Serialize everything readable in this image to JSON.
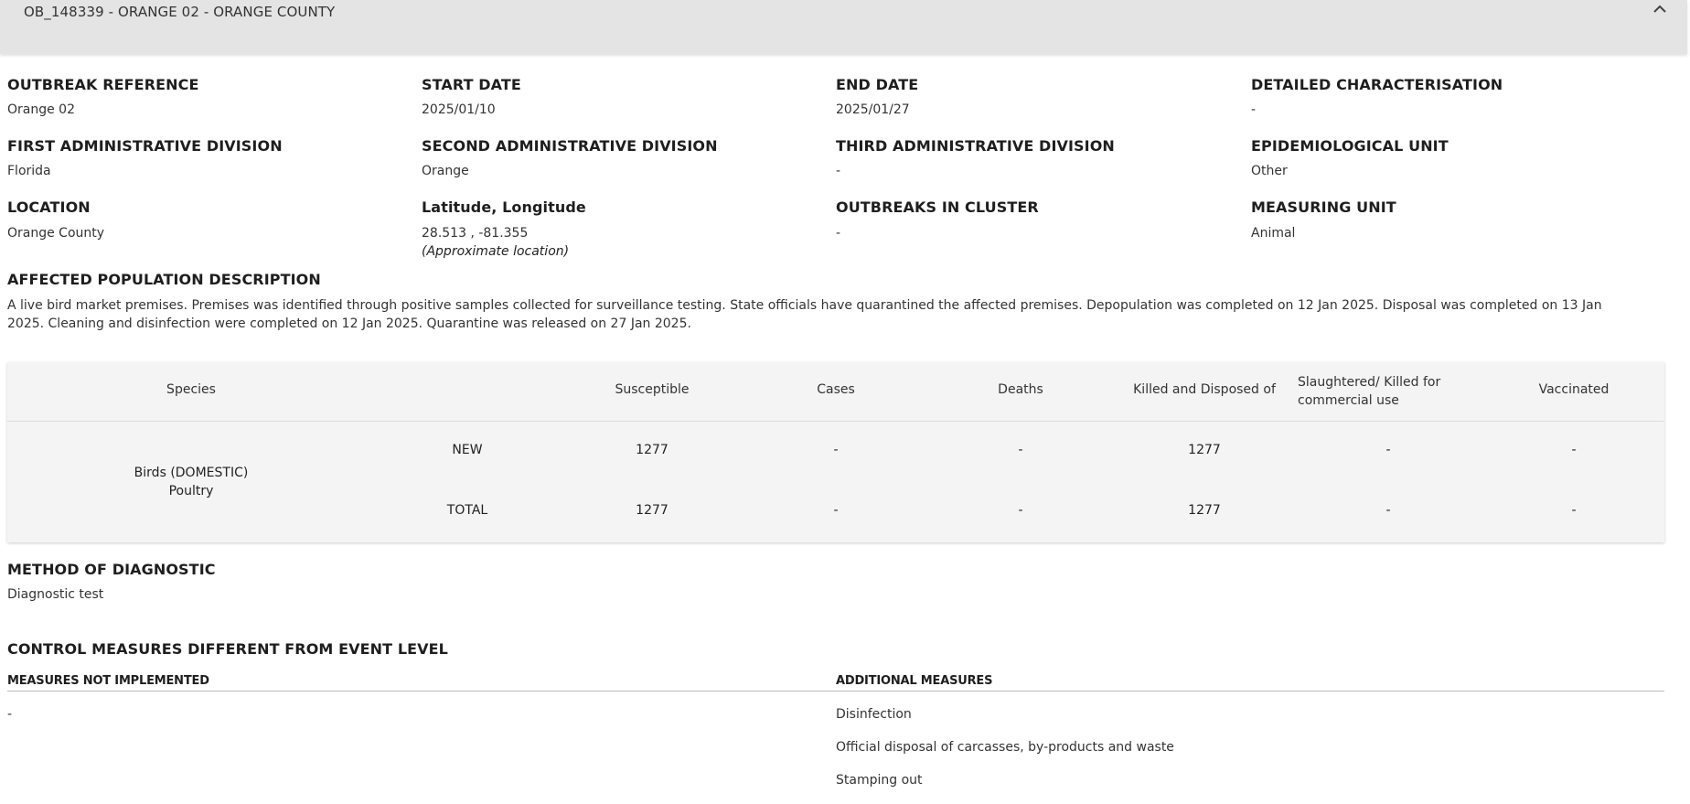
{
  "header": {
    "title": "OB_148339 - ORANGE 02 - ORANGE COUNTY"
  },
  "fields": {
    "outbreak_reference": {
      "label": "OUTBREAK REFERENCE",
      "value": "Orange 02"
    },
    "start_date": {
      "label": "START DATE",
      "value": "2025/01/10"
    },
    "end_date": {
      "label": "END DATE",
      "value": "2025/01/27"
    },
    "detailed_characterisation": {
      "label": "DETAILED CHARACTERISATION",
      "value": "-"
    },
    "first_admin_division": {
      "label": "FIRST ADMINISTRATIVE DIVISION",
      "value": "Florida"
    },
    "second_admin_division": {
      "label": "SECOND ADMINISTRATIVE DIVISION",
      "value": "Orange"
    },
    "third_admin_division": {
      "label": "THIRD ADMINISTRATIVE DIVISION",
      "value": "-"
    },
    "epidemiological_unit": {
      "label": "EPIDEMIOLOGICAL UNIT",
      "value": "Other"
    },
    "location": {
      "label": "LOCATION",
      "value": "Orange County"
    },
    "lat_long": {
      "label": "Latitude, Longitude",
      "value": "28.513 , -81.355",
      "note": "(Approximate location)"
    },
    "outbreaks_in_cluster": {
      "label": "OUTBREAKS IN CLUSTER",
      "value": "-"
    },
    "measuring_unit": {
      "label": "MEASURING UNIT",
      "value": "Animal"
    }
  },
  "affected_population": {
    "label": "AFFECTED POPULATION DESCRIPTION",
    "text": "A live bird market premises. Premises was identified through positive samples collected for surveillance testing. State officials have quarantined the affected premises. Depopulation was completed on 12 Jan 2025. Disposal was completed on 13 Jan 2025. Cleaning and disinfection were completed on 12 Jan 2025. Quarantine was released on 27 Jan 2025."
  },
  "table": {
    "headers": {
      "species": "Species",
      "susceptible": "Susceptible",
      "cases": "Cases",
      "deaths": "Deaths",
      "killed": "Killed and Disposed of",
      "slaughtered_1": "Slaughtered/ Killed for",
      "slaughtered_2": "commercial use",
      "vaccinated": "Vaccinated"
    },
    "species_line1": "Birds (DOMESTIC)",
    "species_line2": "Poultry",
    "rows": [
      {
        "type": "NEW",
        "susceptible": "1277",
        "cases": "-",
        "deaths": "-",
        "killed": "1277",
        "slaughtered": "-",
        "vaccinated": "-"
      },
      {
        "type": "TOTAL",
        "susceptible": "1277",
        "cases": "-",
        "deaths": "-",
        "killed": "1277",
        "slaughtered": "-",
        "vaccinated": "-"
      }
    ]
  },
  "diagnostic": {
    "label": "METHOD OF DIAGNOSTIC",
    "value": "Diagnostic test"
  },
  "control_measures": {
    "title": "CONTROL MEASURES DIFFERENT FROM EVENT LEVEL",
    "not_implemented_label": "MEASURES NOT IMPLEMENTED",
    "not_implemented_value": "-",
    "additional_label": "ADDITIONAL MEASURES",
    "additional": [
      "Disinfection",
      "Official disposal of carcasses, by-products and waste",
      "Stamping out"
    ]
  }
}
